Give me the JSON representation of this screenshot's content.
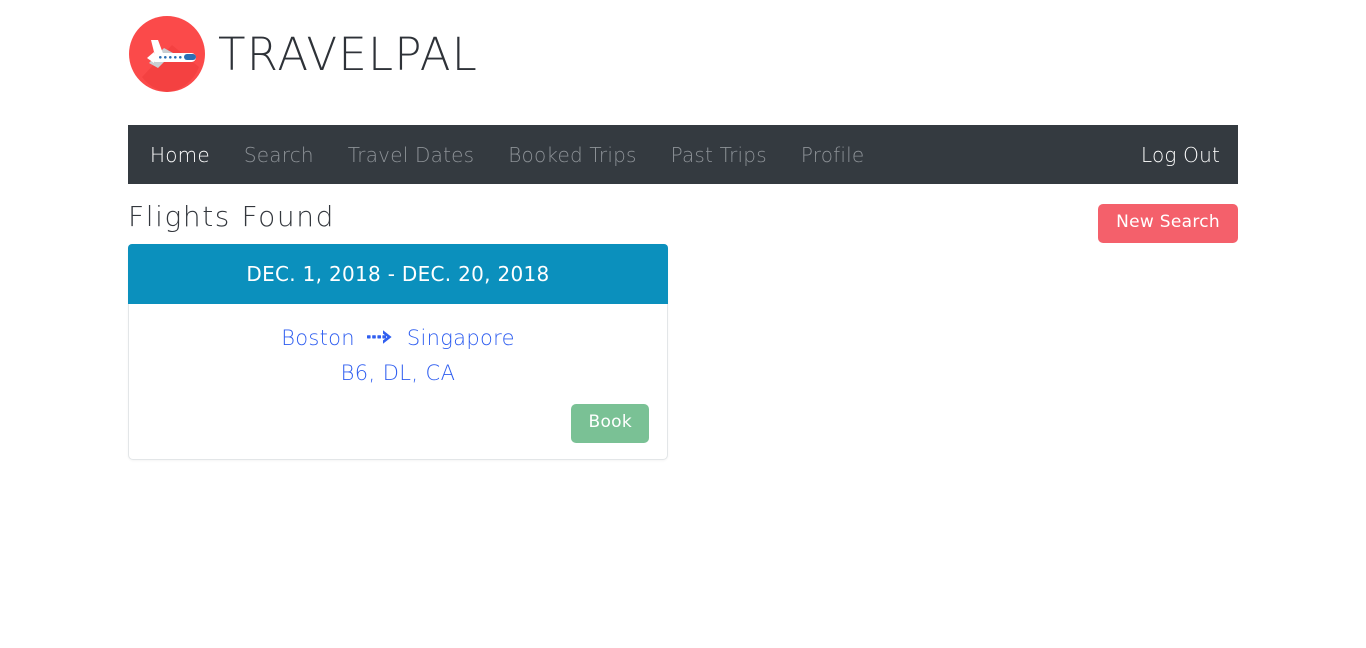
{
  "brand": {
    "name": "TRAVELPAL",
    "logo_icon": "airplane-circle-icon",
    "logo_circle_color": "#fb4a4a",
    "logo_plane_color": "#ffffff"
  },
  "nav": {
    "background_color": "#343a40",
    "items": [
      {
        "label": "Home",
        "active": true
      },
      {
        "label": "Search",
        "active": false
      },
      {
        "label": "Travel Dates",
        "active": false
      },
      {
        "label": "Booked Trips",
        "active": false
      },
      {
        "label": "Past Trips",
        "active": false
      },
      {
        "label": "Profile",
        "active": false
      }
    ],
    "logout_label": "Log Out"
  },
  "main": {
    "page_title": "Flights Found",
    "new_search_label": "New Search",
    "new_search_color": "#f4606b"
  },
  "flight_card": {
    "date_range": "DEC. 1, 2018 - DEC. 20, 2018",
    "header_color": "#0b90bd",
    "origin": "Boston",
    "destination": "Singapore",
    "arrow_icon": "dashed-arrow-right-icon",
    "airlines": "B6, DL, CA",
    "book_label": "Book",
    "book_color": "#7ac195",
    "link_color": "#2f5ef0"
  }
}
